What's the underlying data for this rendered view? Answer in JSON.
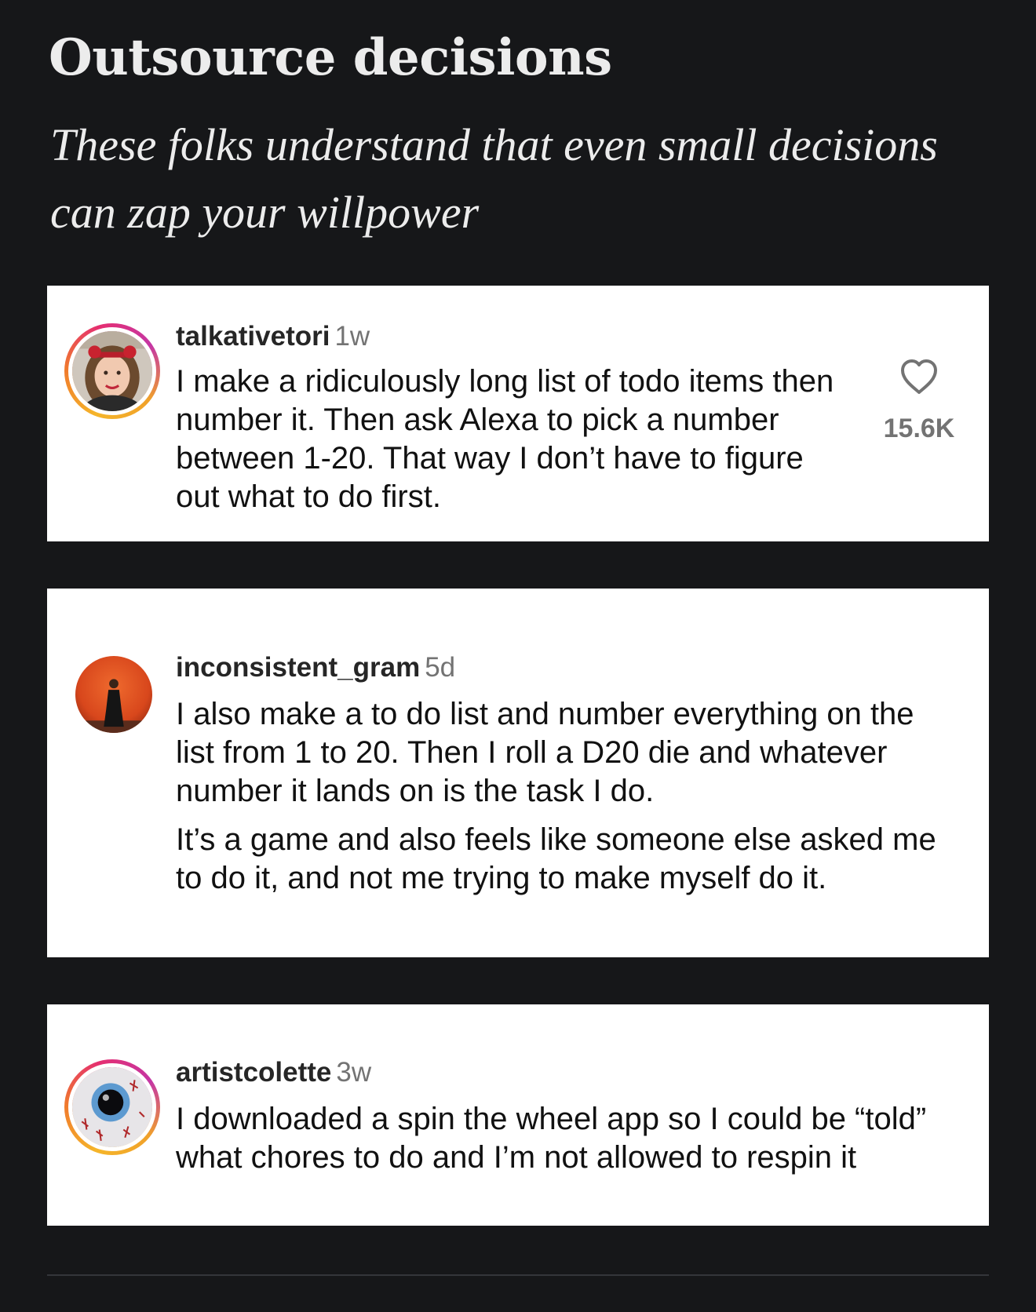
{
  "article": {
    "heading": "Outsource decisions",
    "subheading": "These folks understand that even small decisions can zap your willpower"
  },
  "comments": [
    {
      "username": "talkativetori",
      "age": "1w",
      "text": "I make a ridiculously long list of todo items then number it. Then ask Alexa to pick a number between 1-20. That way I don’t have to figure out what to do first.",
      "likes": "15.6K",
      "avatar_icon": "profile-photo-woman-icon"
    },
    {
      "username": "inconsistent_gram",
      "age": "5d",
      "text": "I also make a to do list and number everything on the list from 1 to 20. Then I roll a D20 die and whatever number it lands on is the task I do.",
      "text_2": "It’s a game and also feels like someone else asked me to do it, and not me trying to make myself do it.",
      "avatar_icon": "profile-photo-figure-icon"
    },
    {
      "username": "artistcolette",
      "age": "3w",
      "text": "I downloaded a spin the wheel app so I could be “told” what chores to do and I’m not allowed to respin it",
      "avatar_icon": "profile-photo-eye-icon"
    }
  ],
  "colors": {
    "page_background": "#161719",
    "card_background": "#ffffff",
    "heading_text": "#ececec",
    "comment_text": "#111111",
    "meta_text": "#737373"
  }
}
